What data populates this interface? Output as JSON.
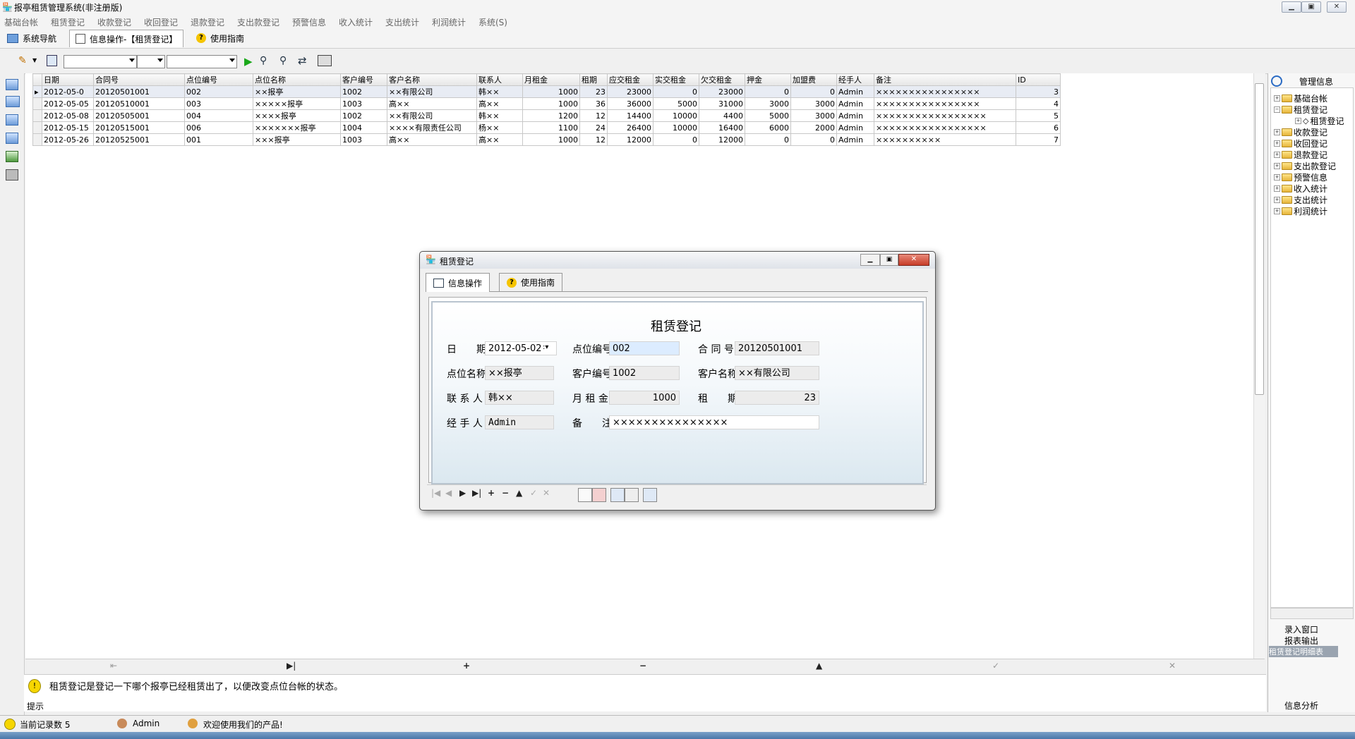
{
  "window": {
    "title": "报亭租赁管理系统(非注册版)"
  },
  "menu": [
    "基础台帐",
    "租赁登记",
    "收款登记",
    "收回登记",
    "退款登记",
    "支出款登记",
    "预警信息",
    "收入统计",
    "支出统计",
    "利润统计",
    "系统(S)"
  ],
  "nav_tabs": [
    {
      "label": "系统导航"
    },
    {
      "label": "信息操作-【租赁登记】"
    },
    {
      "label": "使用指南"
    }
  ],
  "grid": {
    "columns": [
      "日期",
      "合同号",
      "点位编号",
      "点位名称",
      "客户编号",
      "客户名称",
      "联系人",
      "月租金",
      "租期",
      "应交租金",
      "实交租金",
      "欠交租金",
      "押金",
      "加盟费",
      "经手人",
      "备注",
      "ID"
    ],
    "rows": [
      [
        "2012-05-0",
        "20120501001",
        "002",
        "××报亭",
        "1002",
        "××有限公司",
        "韩××",
        "1000",
        "23",
        "23000",
        "0",
        "23000",
        "0",
        "0",
        "Admin",
        "××××××××××××××××",
        "3"
      ],
      [
        "2012-05-05",
        "20120510001",
        "003",
        "×××××报亭",
        "1003",
        "高××",
        "高××",
        "1000",
        "36",
        "36000",
        "5000",
        "31000",
        "3000",
        "3000",
        "Admin",
        "××××××××××××××××",
        "4"
      ],
      [
        "2012-05-08",
        "20120505001",
        "004",
        "××××报亭",
        "1002",
        "××有限公司",
        "韩××",
        "1200",
        "12",
        "14400",
        "10000",
        "4400",
        "5000",
        "3000",
        "Admin",
        "×××××××××××××××××",
        "5"
      ],
      [
        "2012-05-15",
        "20120515001",
        "006",
        "×××××××报亭",
        "1004",
        "××××有限责任公司",
        "杨××",
        "1100",
        "24",
        "26400",
        "10000",
        "16400",
        "6000",
        "2000",
        "Admin",
        "×××××××××××××××××",
        "6"
      ],
      [
        "2012-05-26",
        "20120525001",
        "001",
        "×××报亭",
        "1003",
        "高××",
        "高××",
        "1000",
        "12",
        "12000",
        "0",
        "12000",
        "0",
        "0",
        "Admin",
        "××××××××××",
        "7"
      ]
    ]
  },
  "hint": {
    "text": "租赁登记是登记一下哪个报亭已经租赁出了，以便改变点位台帐的状态。",
    "label": "提示"
  },
  "status": {
    "record_count": "当前记录数 5",
    "user": "Admin",
    "welcome": "欢迎使用我们的产品!"
  },
  "right_panel": {
    "title": "管理信息",
    "tree": [
      "基础台帐",
      "租赁登记",
      "租赁登记",
      "收款登记",
      "收回登记",
      "退款登记",
      "支出款登记",
      "预警信息",
      "收入统计",
      "支出统计",
      "利润统计"
    ],
    "buttons": [
      "录入窗口",
      "报表输出",
      "租赁登记明细表",
      "信息分析"
    ]
  },
  "dialog": {
    "title": "租赁登记",
    "tabs": [
      "信息操作",
      "使用指南"
    ],
    "form_title": "租赁登记",
    "fields": {
      "date_label": "日　　期",
      "date": "2012-05-02",
      "site_no_label": "点位编号",
      "site_no": "002",
      "contract_label": "合 同 号",
      "contract": "20120501001",
      "site_name_label": "点位名称",
      "site_name": "××报亭",
      "cust_no_label": "客户编号",
      "cust_no": "1002",
      "cust_name_label": "客户名称",
      "cust_name": "××有限公司",
      "contact_label": "联 系 人",
      "contact": "韩××",
      "rent_label": "月 租 金",
      "rent": "1000",
      "term_label": "租　　期",
      "term": "23",
      "handler_label": "经 手 人",
      "handler": "Admin",
      "note_label": "备　　注",
      "note": "×××××××××××××××"
    }
  }
}
